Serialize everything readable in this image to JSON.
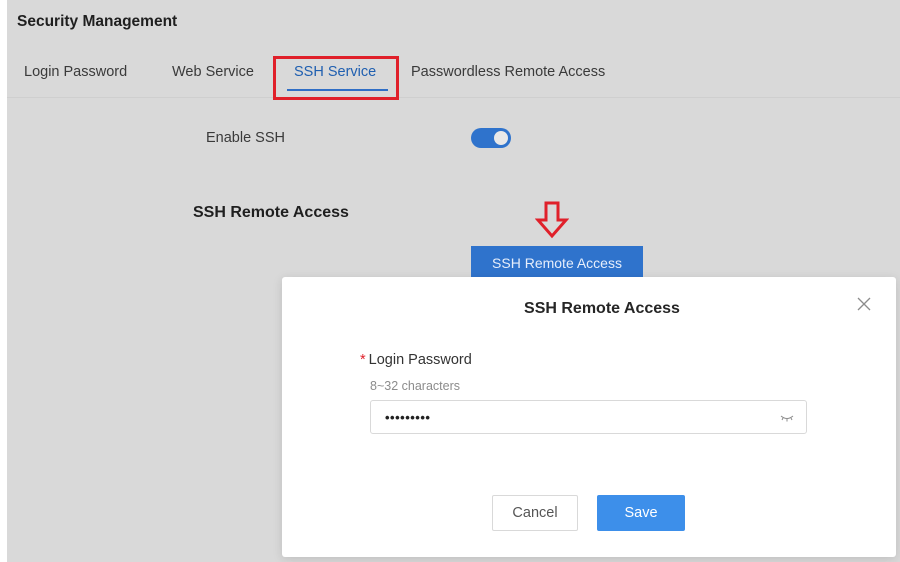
{
  "page": {
    "title": "Security Management"
  },
  "tabs": [
    {
      "label": "Login Password",
      "active": false
    },
    {
      "label": "Web Service",
      "active": false
    },
    {
      "label": "SSH Service",
      "active": true
    },
    {
      "label": "Passwordless Remote Access",
      "active": false
    }
  ],
  "ssh": {
    "enable_label": "Enable SSH",
    "enabled": true,
    "remote_heading": "SSH Remote Access",
    "remote_button": "SSH Remote Access"
  },
  "modal": {
    "title": "SSH Remote Access",
    "required_mark": "*",
    "field_label": "Login Password",
    "field_hint": "8~32 characters",
    "password_value": "•••••••••",
    "cancel_label": "Cancel",
    "save_label": "Save"
  },
  "colors": {
    "accent": "#2f73cc",
    "save_button": "#3d8fea",
    "annotation_red": "#e0202a",
    "overlay_background": "#d9d9d9"
  },
  "icons": [
    "close-icon",
    "eye-closed-icon",
    "down-arrow-annotation-icon"
  ]
}
